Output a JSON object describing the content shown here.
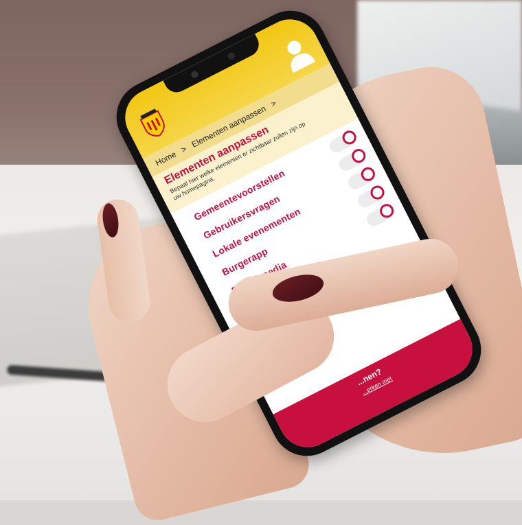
{
  "app": {
    "breadcrumb": [
      "Home",
      "Elementen aanpassen"
    ],
    "breadcrumb_separator": ">",
    "title": "Elementen aanpassen",
    "description": "Bepaal hier welke elementen er zichtbaar zullen zijn op uw homepagina.",
    "settings": [
      {
        "label": "Gemeentevoorstellen",
        "enabled": true
      },
      {
        "label": "Gebruikersvragen",
        "enabled": true
      },
      {
        "label": "Lokale evenementen",
        "enabled": true
      },
      {
        "label": "Burgerapp",
        "enabled": true
      },
      {
        "label": "Social media",
        "enabled": true
      }
    ],
    "footer": {
      "question": "...nen?",
      "link": "...erken met"
    }
  },
  "colors": {
    "brand_red": "#c8103f",
    "header_yellow": "#f2c613",
    "breadcrumb_bg": "#f2dd8f",
    "subheader_bg": "#fbf1cc",
    "nail": "#5a1a20"
  },
  "icons": {
    "logo": "municipality-crest-icon",
    "account": "user-icon",
    "toggle": "toggle-switch"
  }
}
